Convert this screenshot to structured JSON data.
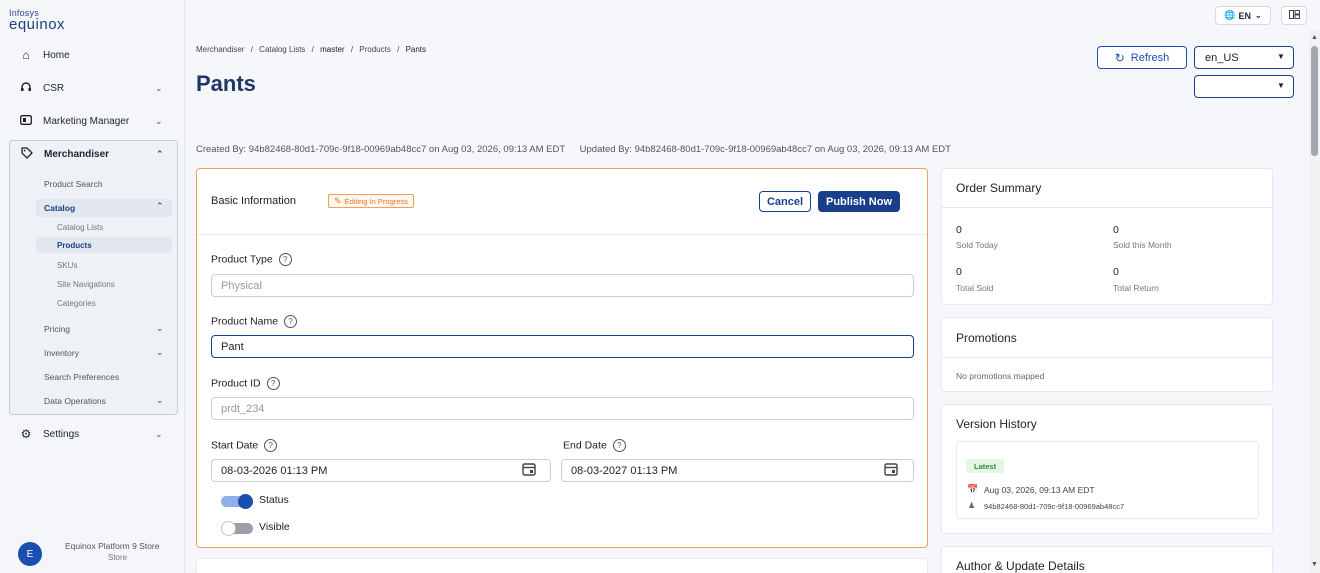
{
  "brand": {
    "line1": "Infosys",
    "line2": "equinox"
  },
  "topbar": {
    "lang": "EN",
    "lang_icon": "globe-icon",
    "grid_icon": "layout-icon"
  },
  "sidebar": {
    "home": "Home",
    "csr": "CSR",
    "marketing": "Marketing Manager",
    "merchandiser": "Merchandiser",
    "product_search": "Product Search",
    "catalog": "Catalog",
    "catalog_lists": "Catalog Lists",
    "products": "Products",
    "skus": "SKUs",
    "site_navigations": "Site Navigations",
    "categories": "Categories",
    "pricing": "Pricing",
    "inventory": "Inventory",
    "search_preferences": "Search Preferences",
    "data_operations": "Data Operations",
    "settings": "Settings",
    "footer_initial": "E",
    "footer_line1": "Equinox Platform 9 Store",
    "footer_line2": "Store"
  },
  "breadcrumb": {
    "b1": "Merchandiser",
    "b2": "Catalog Lists",
    "b3": "master",
    "b4": "Products",
    "b5": "Pants",
    "sep": "/"
  },
  "page_title": "Pants",
  "header": {
    "refresh": "Refresh",
    "locale": "en_US",
    "second_select": ""
  },
  "meta": {
    "created": "Created By: 94b82468-80d1-709c-9f18-00969ab48cc7 on Aug 03, 2026, 09:13 AM EDT",
    "updated": "Updated By: 94b82468-80d1-709c-9f18-00969ab48cc7 on Aug 03, 2026, 09:13 AM EDT"
  },
  "basic": {
    "title": "Basic Information",
    "badge": "Editing In Progress",
    "cancel": "Cancel",
    "publish": "Publish Now",
    "product_type_label": "Product Type",
    "product_type_value": "Physical",
    "product_name_label": "Product Name",
    "product_name_value": "Pant",
    "product_id_label": "Product ID",
    "product_id_value": "prdt_234",
    "start_date_label": "Start Date",
    "start_date_value": "08-03-2026 01:13 PM",
    "end_date_label": "End Date",
    "end_date_value": "08-03-2027 01:13 PM",
    "status_label": "Status",
    "status_on": true,
    "visible_label": "Visible",
    "visible_on": false
  },
  "order_summary": {
    "title": "Order Summary",
    "sold_today": "0",
    "sold_today_label": "Sold Today",
    "sold_month": "0",
    "sold_month_label": "Sold this Month",
    "total_sold": "0",
    "total_sold_label": "Total Sold",
    "total_return": "0",
    "total_return_label": "Total Return"
  },
  "promotions": {
    "title": "Promotions",
    "empty": "No promotions mapped"
  },
  "version_history": {
    "title": "Version History",
    "badge": "Latest",
    "date": "Aug 03, 2026, 09:13 AM EDT",
    "user": "94b82468-80d1-709c-9f18-00969ab48cc7"
  },
  "author_panel": {
    "title": "Author & Update Details"
  },
  "colors": {
    "primary": "#1a4fb0",
    "accent_orange": "#f0a05a",
    "title": "#1e3766"
  }
}
